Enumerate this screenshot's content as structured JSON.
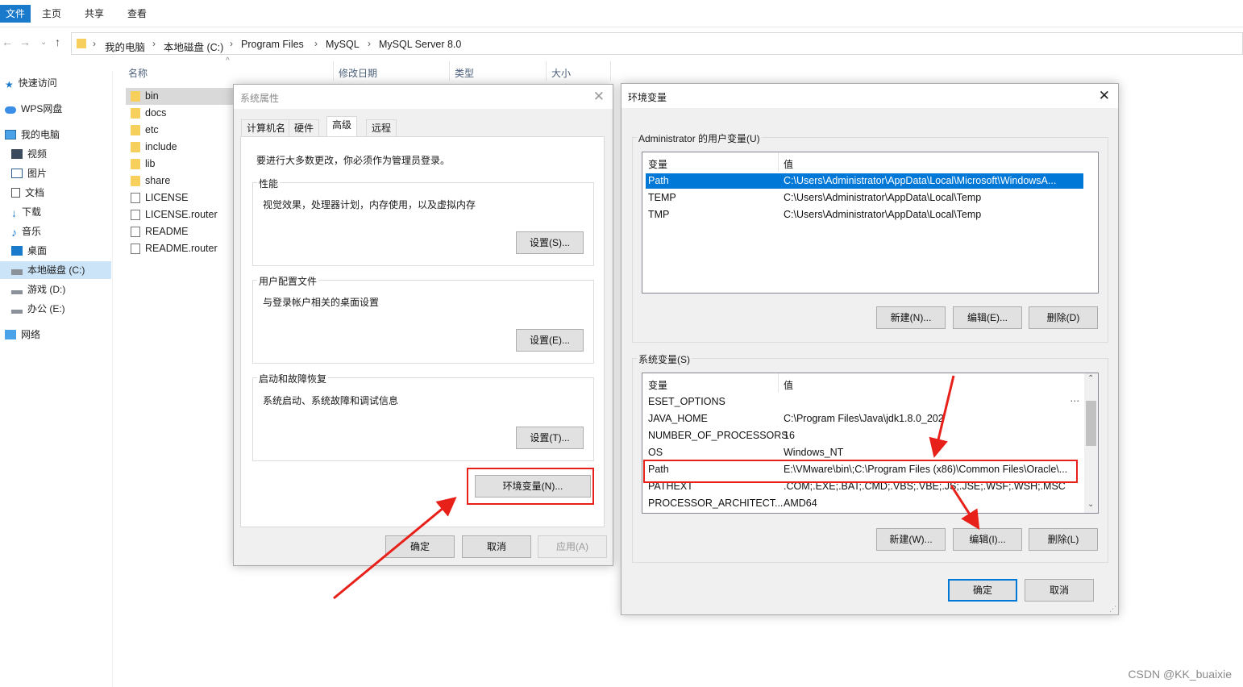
{
  "ribbon": {
    "tabs": [
      "文件",
      "主页",
      "共享",
      "查看"
    ]
  },
  "breadcrumb": [
    "我的电脑",
    "本地磁盘 (C:)",
    "Program Files",
    "MySQL",
    "MySQL Server 8.0"
  ],
  "nav_pane": {
    "quick_access": "快速访问",
    "wps": "WPS网盘",
    "this_pc": "我的电脑",
    "items": [
      "视频",
      "图片",
      "文档",
      "下载",
      "音乐",
      "桌面",
      "本地磁盘 (C:)",
      "游戏 (D:)",
      "办公 (E:)"
    ],
    "network": "网络"
  },
  "file_list": {
    "columns": [
      "名称",
      "修改日期",
      "类型",
      "大小"
    ],
    "items": [
      {
        "name": "bin",
        "kind": "folder"
      },
      {
        "name": "docs",
        "kind": "folder"
      },
      {
        "name": "etc",
        "kind": "folder"
      },
      {
        "name": "include",
        "kind": "folder"
      },
      {
        "name": "lib",
        "kind": "folder"
      },
      {
        "name": "share",
        "kind": "folder"
      },
      {
        "name": "LICENSE",
        "kind": "file"
      },
      {
        "name": "LICENSE.router",
        "kind": "file"
      },
      {
        "name": "README",
        "kind": "file"
      },
      {
        "name": "README.router",
        "kind": "file"
      }
    ]
  },
  "sysprops": {
    "title": "系统属性",
    "tabs": [
      "计算机名",
      "硬件",
      "高级",
      "远程"
    ],
    "admin_note": "要进行大多数更改，你必须作为管理员登录。",
    "performance": {
      "label": "性能",
      "desc": "视觉效果，处理器计划，内存使用，以及虚拟内存",
      "button": "设置(S)..."
    },
    "profiles": {
      "label": "用户配置文件",
      "desc": "与登录帐户相关的桌面设置",
      "button": "设置(E)..."
    },
    "startup": {
      "label": "启动和故障恢复",
      "desc": "系统启动、系统故障和调试信息",
      "button": "设置(T)..."
    },
    "env_button": "环境变量(N)...",
    "ok": "确定",
    "cancel": "取消",
    "apply": "应用(A)"
  },
  "envvars": {
    "title": "环境变量",
    "user_group": "Administrator 的用户变量(U)",
    "col_var": "变量",
    "col_val": "值",
    "user_vars": [
      {
        "name": "Path",
        "value": "C:\\Users\\Administrator\\AppData\\Local\\Microsoft\\WindowsA..."
      },
      {
        "name": "TEMP",
        "value": "C:\\Users\\Administrator\\AppData\\Local\\Temp"
      },
      {
        "name": "TMP",
        "value": "C:\\Users\\Administrator\\AppData\\Local\\Temp"
      }
    ],
    "user_buttons": [
      "新建(N)...",
      "编辑(E)...",
      "删除(D)"
    ],
    "sys_group": "系统变量(S)",
    "sys_vars": [
      {
        "name": "ESET_OPTIONS",
        "value": ""
      },
      {
        "name": "JAVA_HOME",
        "value": "C:\\Program Files\\Java\\jdk1.8.0_202"
      },
      {
        "name": "NUMBER_OF_PROCESSORS",
        "value": "16"
      },
      {
        "name": "OS",
        "value": "Windows_NT"
      },
      {
        "name": "Path",
        "value": "E:\\VMware\\bin\\;C:\\Program Files (x86)\\Common Files\\Oracle\\..."
      },
      {
        "name": "PATHEXT",
        "value": ".COM;.EXE;.BAT;.CMD;.VBS;.VBE;.JS;.JSE;.WSF;.WSH;.MSC"
      },
      {
        "name": "PROCESSOR_ARCHITECT...",
        "value": "AMD64"
      }
    ],
    "sys_buttons": [
      "新建(W)...",
      "编辑(I)...",
      "删除(L)"
    ],
    "ok": "确定",
    "cancel": "取消"
  },
  "watermark": "CSDN @KK_buaixie",
  "colors": {
    "accent": "#0078d7",
    "highlight": "#e8201a",
    "selection": "#cce4f7"
  }
}
